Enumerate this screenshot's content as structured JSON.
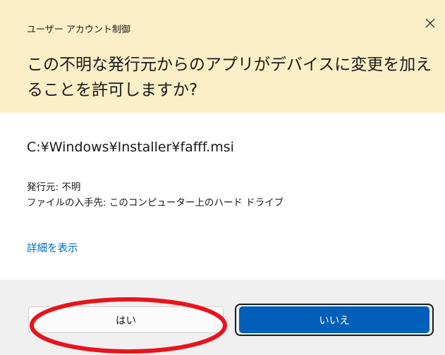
{
  "dialog": {
    "title": "ユーザー アカウント制御",
    "question": "この不明な発行元からのアプリがデバイスに変更を加えることを許可しますか?",
    "file_path": "C:¥Windows¥Installer¥fafff.msi",
    "publisher_line": "発行元: 不明",
    "source_line": "ファイルの入手先: このコンピューター上のハード ドライブ",
    "details_link": "詳細を表示",
    "yes_label": "はい",
    "no_label": "いいえ",
    "close_icon": "close-icon"
  },
  "colors": {
    "header_bg": "#fcefc7",
    "footer_bg": "#f0f0f0",
    "accent": "#005fb8",
    "link": "#0067c0",
    "annotation": "#e8141c"
  }
}
